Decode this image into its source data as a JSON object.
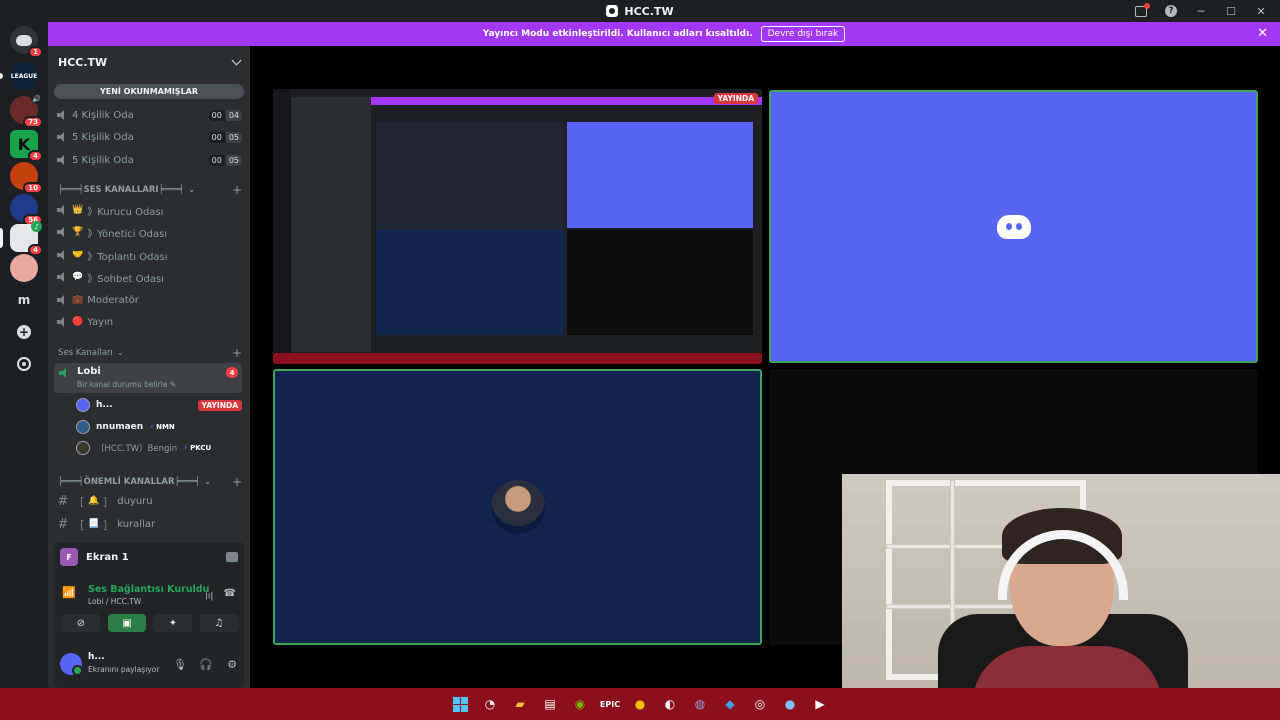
{
  "window": {
    "title": "HCC.TW"
  },
  "banner": {
    "text": "Yayıncı Modu etkinleştirildi. Kullanıcı adları kısaltıldı.",
    "button": "Devre dışı bırak",
    "close": "✕"
  },
  "rail": {
    "home_badge": "1",
    "servers": [
      {
        "badge": "",
        "label": "LEAGUE"
      },
      {
        "badge": "73",
        "label": ""
      },
      {
        "badge": "4",
        "label": "K"
      },
      {
        "badge": "10",
        "label": ""
      },
      {
        "badge": "56",
        "label": ""
      },
      {
        "badge": "4",
        "label": ""
      },
      {
        "badge": "",
        "label": ""
      },
      {
        "badge": "",
        "label": "m"
      }
    ],
    "add": "+"
  },
  "sidebar": {
    "server_name": "HCC.TW",
    "unread": "YENİ OKUNMAMIŞLAR",
    "channels_top": [
      {
        "name": "4 Kişilik Oda",
        "c1": "00",
        "c2": "04"
      },
      {
        "name": "5 Kişilik Oda",
        "c1": "00",
        "c2": "05"
      },
      {
        "name": "5 Kişilik Oda",
        "c1": "00",
        "c2": "05"
      }
    ],
    "cat_ses": "╞═══╡SES KANALLARI╞═══╡",
    "ses_channels": [
      {
        "emoji": "👑",
        "name": "》Kurucu Odası"
      },
      {
        "emoji": "🏆",
        "name": "》Yönetici Odası"
      },
      {
        "emoji": "🤝",
        "name": "》Toplantı Odası"
      },
      {
        "emoji": "💬",
        "name": "》Sohbet Odası"
      },
      {
        "emoji": "💼",
        "name": "Moderatör"
      },
      {
        "emoji": "🔴",
        "name": "Yayın"
      }
    ],
    "cat_voice": "Ses Kanalları",
    "lobby": {
      "name": "Lobi",
      "status": "Bir kanal durumu belirle ✎",
      "badge": "4"
    },
    "voice_users": [
      {
        "name": "h...",
        "tag": "",
        "live": "YAYINDA"
      },
      {
        "name": "nnumaen",
        "tag": "NMN",
        "live": ""
      },
      {
        "name": "〔HCC.TW〕Bengin",
        "tag": "PKCU",
        "live": ""
      }
    ],
    "cat_important": "╞═══╡ÖNEMLİ KANALLAR╞═══╡",
    "text_channels": [
      {
        "emoji": "🔔",
        "name": "duyuru"
      },
      {
        "emoji": "📃",
        "name": "kurallar"
      }
    ]
  },
  "voice_panel": {
    "screen_initial": "F",
    "screen_name": "Ekran 1",
    "connected": "Ses Bağlantısı Kuruldu",
    "location": "Lobi / HCC.TW",
    "user_name": "h...",
    "user_status": "Ekranını paylaşıyor"
  },
  "main": {
    "nested_live": "YAYINDA"
  },
  "colors": {
    "blurple": "#5865f2",
    "banner": "#a238f5",
    "live": "#da373c",
    "connected": "#23a55a",
    "taskbar": "#8e0f1c"
  },
  "taskbar_icons": [
    "windows-start",
    "speed-icon",
    "folder-icon",
    "store-icon",
    "nvidia-icon",
    "epic-icon",
    "chrome-icon",
    "steam-icon",
    "discord-icon",
    "vscode-icon",
    "obs-icon",
    "chrome-dev-icon",
    "media-player-icon"
  ]
}
